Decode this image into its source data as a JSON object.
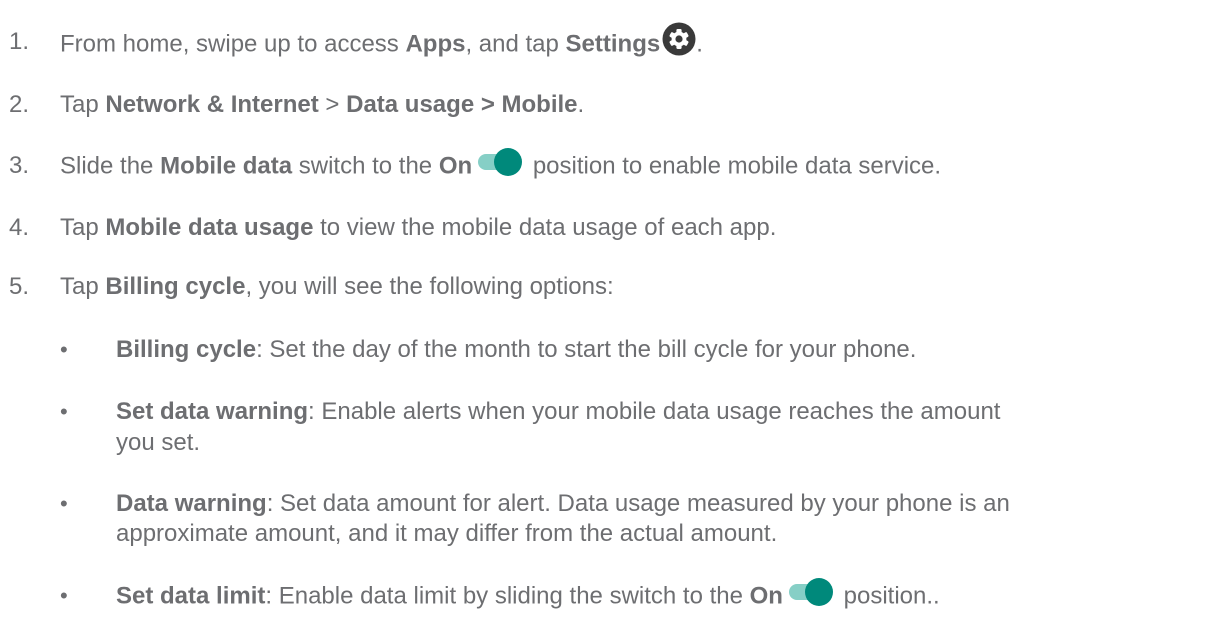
{
  "colors": {
    "text": "#6d6e71",
    "icon_dark": "#3a3a3a",
    "toggle_track": "#86cfc6",
    "toggle_knob": "#00897b"
  },
  "steps": [
    {
      "number": "1.",
      "parts": [
        "From home, swipe up to access ",
        "Apps",
        ", and tap ",
        "Settings",
        "."
      ],
      "icon": "gear-icon"
    },
    {
      "number": "2.",
      "parts": [
        "Tap ",
        "Network & Internet",
        " > ",
        "Data usage > Mobile",
        "."
      ]
    },
    {
      "number": "3.",
      "parts": [
        "Slide the ",
        "Mobile data",
        " switch to the ",
        "On",
        " position to enable mobile data service."
      ],
      "icon": "toggle-on-icon"
    },
    {
      "number": "4.",
      "parts": [
        "Tap ",
        "Mobile data usage",
        " to view the mobile data usage of each app."
      ]
    },
    {
      "number": "5.",
      "parts": [
        "Tap ",
        "Billing cycle",
        ", you will see the following options:"
      ]
    }
  ],
  "bullets": [
    {
      "symbol": "•",
      "term": "Billing cycle",
      "lines": [
        ": Set the day of the month to start the bill cycle for your phone."
      ]
    },
    {
      "symbol": "•",
      "term": "Set data warning",
      "lines": [
        ": Enable alerts when your mobile data usage reaches the amount",
        "you set."
      ]
    },
    {
      "symbol": "•",
      "term": "Data warning",
      "lines": [
        ": Set data amount for alert. Data usage measured by your phone is an",
        "approximate amount, and it may differ from the actual amount."
      ]
    },
    {
      "symbol": "•",
      "term": "Set data limit",
      "lines": [
        ": Enable data limit by sliding the switch to the ",
        " position.."
      ],
      "inline_bold": "On",
      "icon": "toggle-on-icon"
    }
  ]
}
